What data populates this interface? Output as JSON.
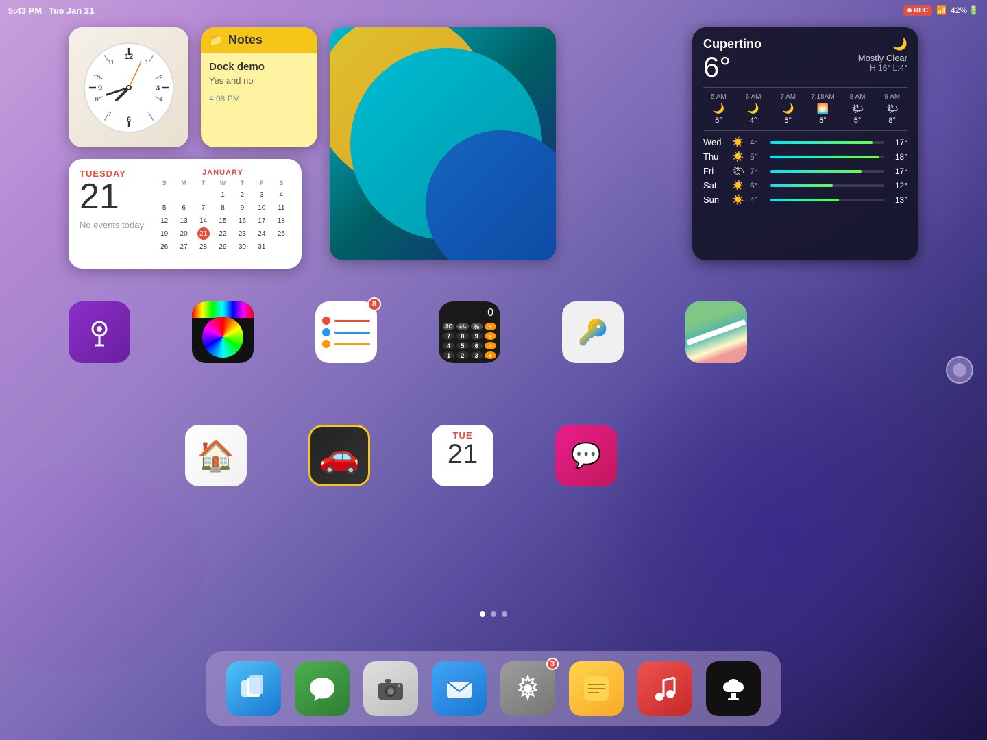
{
  "statusBar": {
    "time": "5:43 PM",
    "date": "Tue Jan 21",
    "rec": "REC",
    "wifi": "42%",
    "battery": "42%"
  },
  "clockWidget": {
    "label": "Clock"
  },
  "notesWidget": {
    "title": "Notes",
    "noteTitle": "Dock demo",
    "noteSubtitle": "Yes and no",
    "noteTime": "4:08 PM"
  },
  "weatherWidget": {
    "city": "Cupertino",
    "temp": "6°",
    "description": "Mostly Clear",
    "highLow": "H:16° L:4°",
    "hourly": [
      {
        "time": "5 AM",
        "icon": "🌙",
        "temp": "5°"
      },
      {
        "time": "6 AM",
        "icon": "🌙",
        "temp": "4°"
      },
      {
        "time": "7 AM",
        "icon": "🌙",
        "temp": "5°"
      },
      {
        "time": "7:18AM",
        "icon": "🌅",
        "temp": "5°"
      },
      {
        "time": "8 AM",
        "icon": "🌤",
        "temp": "5°"
      },
      {
        "time": "9 AM",
        "icon": "🌤",
        "temp": "8°"
      }
    ],
    "forecast": [
      {
        "day": "Wed",
        "icon": "☀️",
        "low": "4°",
        "high": "17°",
        "barWidth": "90%"
      },
      {
        "day": "Thu",
        "icon": "☀️",
        "low": "5°",
        "high": "18°",
        "barWidth": "95%"
      },
      {
        "day": "Fri",
        "icon": "🌤",
        "low": "7°",
        "high": "17°",
        "barWidth": "80%"
      },
      {
        "day": "Sat",
        "icon": "☀️",
        "low": "6°",
        "high": "12°",
        "barWidth": "55%"
      },
      {
        "day": "Sun",
        "icon": "☀️",
        "low": "4°",
        "high": "13°",
        "barWidth": "60%"
      }
    ]
  },
  "calendarWidget": {
    "dayName": "TUESDAY",
    "dayNum": "21",
    "monthName": "JANUARY",
    "noEvents": "No events today",
    "daysOfWeek": [
      "S",
      "M",
      "T",
      "W",
      "T",
      "F",
      "S"
    ],
    "weeks": [
      [
        "",
        "",
        "",
        "1",
        "2",
        "3",
        "4"
      ],
      [
        "5",
        "6",
        "7",
        "8",
        "9",
        "10",
        "11"
      ],
      [
        "12",
        "13",
        "14",
        "15",
        "16",
        "17",
        "18"
      ],
      [
        "19",
        "20",
        "21",
        "22",
        "23",
        "24",
        "25"
      ],
      [
        "26",
        "27",
        "28",
        "29",
        "30",
        "31",
        ""
      ]
    ],
    "todayDate": "21"
  },
  "apps": {
    "row1": [
      {
        "name": "Podcasts",
        "badge": null
      },
      {
        "name": "Pastel",
        "badge": null
      },
      {
        "name": "Reminders",
        "badge": "8"
      },
      {
        "name": "Calculator",
        "badge": null
      },
      {
        "name": "Passwords",
        "badge": null
      },
      {
        "name": "Maps",
        "badge": null
      }
    ],
    "row2": [
      {
        "name": "Home",
        "badge": null
      },
      {
        "name": "Road Rush",
        "badge": null
      },
      {
        "name": "Calendar",
        "badge": null
      },
      {
        "name": "Speeko",
        "badge": null
      }
    ]
  },
  "pageDots": [
    {
      "active": true
    },
    {
      "active": false
    },
    {
      "active": false
    }
  ],
  "dock": {
    "items": [
      {
        "name": "Files",
        "badge": null
      },
      {
        "name": "Messages",
        "badge": null
      },
      {
        "name": "Camera",
        "badge": null
      },
      {
        "name": "Mail",
        "badge": null
      },
      {
        "name": "Settings",
        "badge": "3"
      },
      {
        "name": "Notes",
        "badge": null
      },
      {
        "name": "Music",
        "badge": null
      },
      {
        "name": "Apple TV",
        "badge": null
      }
    ]
  }
}
